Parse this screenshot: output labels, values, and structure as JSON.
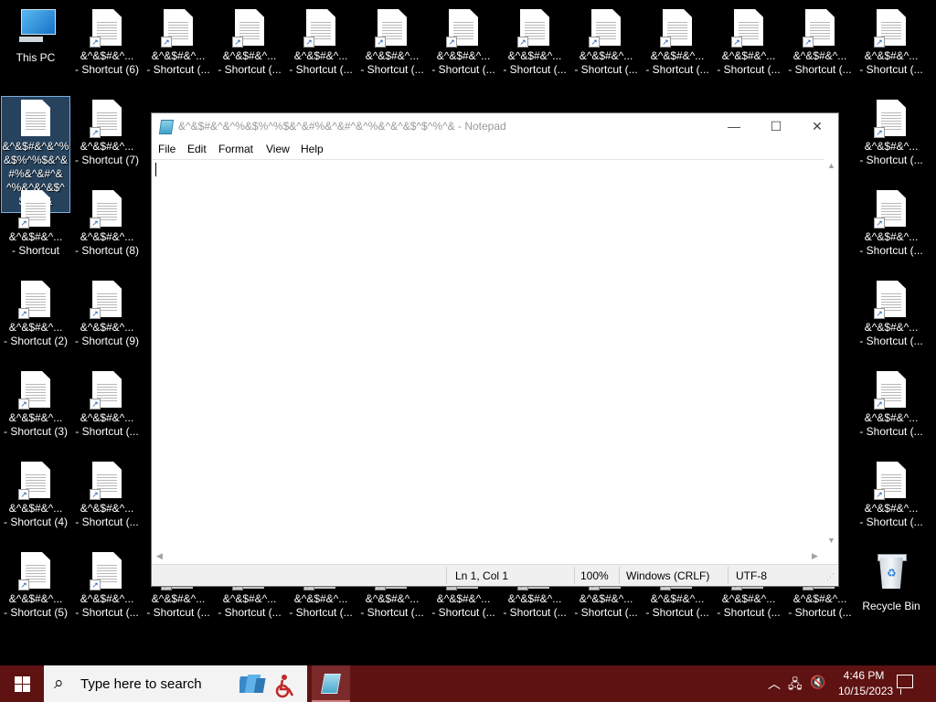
{
  "desktop": {
    "icons": {
      "this_pc": "This PC",
      "recycle_bin": "Recycle Bin",
      "selected_full": "&^&$#&^&^%&$%^%$&^&#%&^&#^&^%&^&^&$^$^%^&",
      "c0r1": [
        "&^&$#&^...",
        "- Shortcut"
      ],
      "c0r2": [
        "&^&$#&^...",
        "- Shortcut (2)"
      ],
      "c0r3": [
        "&^&$#&^...",
        "- Shortcut (3)"
      ],
      "c0r4": [
        "&^&$#&^...",
        "- Shortcut (4)"
      ],
      "c0r5": [
        "&^&$#&^...",
        "- Shortcut (5)"
      ],
      "c1r0": [
        "&^&$#&^...",
        "- Shortcut (6)"
      ],
      "c1r1": [
        "&^&$#&^...",
        "- Shortcut (7)"
      ],
      "c1r2": [
        "&^&$#&^...",
        "- Shortcut (8)"
      ],
      "c1r3": [
        "&^&$#&^...",
        "- Shortcut (9)"
      ],
      "c1r4": [
        "&^&$#&^...",
        "- Shortcut (..."
      ],
      "c1r5": [
        "&^&$#&^...",
        "- Shortcut (..."
      ],
      "c1r6": [
        "&^&$#&^...",
        "- Shortcut (..."
      ],
      "generic": [
        "&^&$#&^...",
        "- Shortcut (..."
      ]
    }
  },
  "notepad": {
    "title": "&^&$#&^&^%&$%^%$&^&#%&^&#^&^%&^&^&$^$^%^& - Notepad",
    "menu": [
      "File",
      "Edit",
      "Format",
      "View",
      "Help"
    ],
    "content": "",
    "status": {
      "position": "Ln 1, Col 1",
      "zoom": "100%",
      "line_endings": "Windows (CRLF)",
      "encoding": "UTF-8"
    },
    "buttons": {
      "minimize": "—",
      "maximize": "☐",
      "close": "✕"
    }
  },
  "taskbar": {
    "search_placeholder": "Type here to search",
    "time": "4:46 PM",
    "date": "10/15/2023"
  },
  "colors": {
    "taskbar": "#5e1212",
    "desktop": "#000000"
  }
}
